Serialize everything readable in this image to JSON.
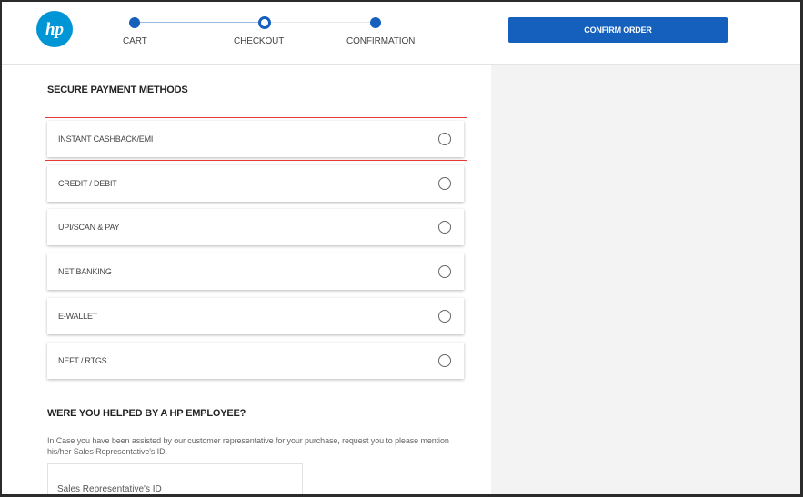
{
  "header": {
    "logo_text": "hp",
    "brand_color": "#0096d6",
    "accent_color": "#1560bd",
    "steps": [
      {
        "label": "CART",
        "state": "done"
      },
      {
        "label": "CHECKOUT",
        "state": "current"
      },
      {
        "label": "CONFIRMATION",
        "state": "pending"
      }
    ],
    "confirm_button": "CONFIRM ORDER"
  },
  "payment": {
    "title": "SECURE PAYMENT METHODS",
    "highlighted_index": 0,
    "methods": [
      {
        "label": "INSTANT CASHBACK/EMI",
        "selected": false
      },
      {
        "label": "CREDIT / DEBIT",
        "selected": false
      },
      {
        "label": "UPI/SCAN & PAY",
        "selected": false
      },
      {
        "label": "NET BANKING",
        "selected": false
      },
      {
        "label": "E-WALLET",
        "selected": false
      },
      {
        "label": "NEFT / RTGS",
        "selected": false
      }
    ]
  },
  "employee": {
    "title": "WERE YOU HELPED BY A HP EMPLOYEE?",
    "description": "In Case you have been assisted by our customer representative for your purchase, request you to please mention his/her Sales Representative's ID.",
    "input_placeholder": "Sales Representative's ID",
    "input_value": ""
  }
}
